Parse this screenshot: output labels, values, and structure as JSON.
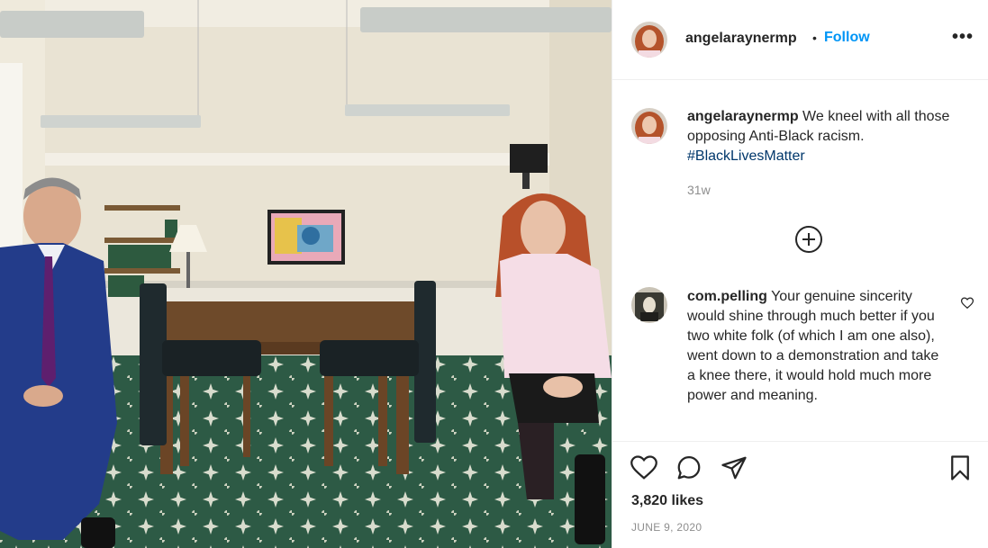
{
  "post": {
    "username": "angelaraynermp",
    "follow_separator": "•",
    "follow_label": "Follow",
    "more_label": "•••",
    "caption_text": " We kneel with all those opposing Anti-Black racism. ",
    "hashtag": "#BlackLivesMatter",
    "time_ago": "31w",
    "likes": "3,820 likes",
    "date": "JUNE 9, 2020"
  },
  "comment": {
    "username": "com.pelling",
    "text": " Your genuine sincerity would shine through much better if you two white folk (of which I am one also), went down to a demonstration and take a knee there, it would hold much more power and meaning."
  },
  "icons": {
    "more": "more-options-icon",
    "load_more": "plus-circle-icon",
    "comment_like": "heart-icon",
    "like": "heart-icon",
    "comment": "comment-icon",
    "share": "share-icon",
    "save": "bookmark-icon"
  },
  "colors": {
    "link": "#0095f6",
    "hashtag": "#00376b",
    "muted": "#8e8e8e"
  }
}
